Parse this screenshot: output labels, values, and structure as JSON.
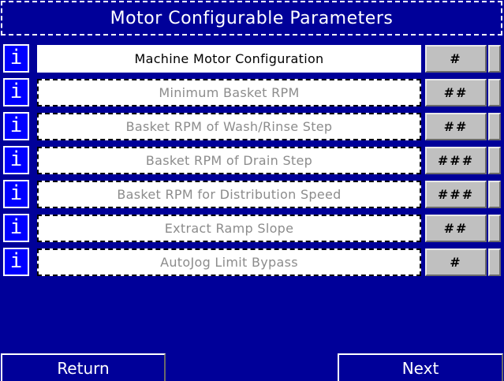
{
  "header": {
    "title": "Motor Configurable Parameters"
  },
  "parameters": [
    {
      "info": "i",
      "label": "Machine Motor Configuration",
      "value": "#",
      "selected": true
    },
    {
      "info": "i",
      "label": "Minimum Basket RPM",
      "value": "##",
      "selected": false
    },
    {
      "info": "i",
      "label": "Basket RPM of Wash/Rinse Step",
      "value": "##",
      "selected": false
    },
    {
      "info": "i",
      "label": "Basket RPM of Drain Step",
      "value": "###",
      "selected": false
    },
    {
      "info": "i",
      "label": "Basket RPM for Distribution Speed",
      "value": "###",
      "selected": false
    },
    {
      "info": "i",
      "label": "Extract Ramp Slope",
      "value": "##",
      "selected": false
    },
    {
      "info": "i",
      "label": "AutoJog Limit Bypass",
      "value": "#",
      "selected": false
    }
  ],
  "footer": {
    "return_label": "Return",
    "next_label": "Next"
  },
  "colors": {
    "background": "#000099",
    "info_button": "#0000ff",
    "value_field": "#c0c0c0",
    "inactive_text": "#8c8c8c"
  }
}
